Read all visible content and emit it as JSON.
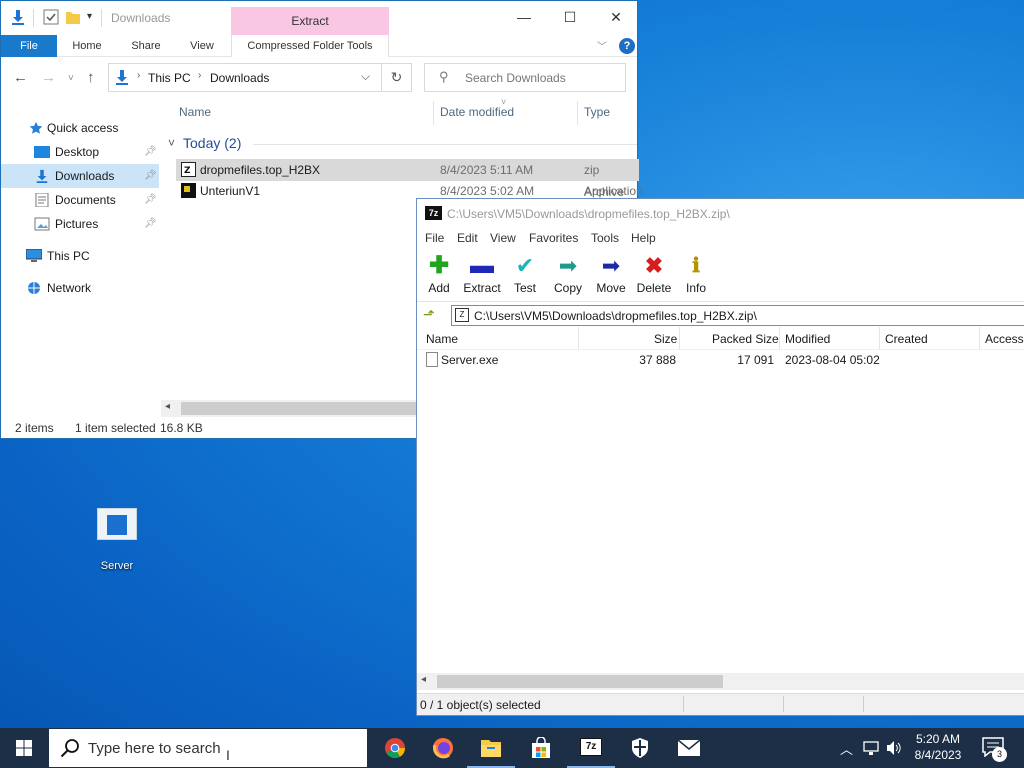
{
  "explorer": {
    "title": "Downloads",
    "context_tab": "Extract",
    "ribbon_tabs": [
      "File",
      "Home",
      "Share",
      "View",
      "Compressed Folder Tools"
    ],
    "breadcrumb": [
      "This PC",
      "Downloads"
    ],
    "search_placeholder": "Search Downloads",
    "nav": [
      {
        "label": "Quick access",
        "icon": "star-icon",
        "pinned": false
      },
      {
        "label": "Desktop",
        "icon": "desktop-folder-icon",
        "pinned": true
      },
      {
        "label": "Downloads",
        "icon": "downloads-icon",
        "pinned": true,
        "selected": true
      },
      {
        "label": "Documents",
        "icon": "documents-icon",
        "pinned": true
      },
      {
        "label": "Pictures",
        "icon": "pictures-icon",
        "pinned": true
      },
      {
        "label": "This PC",
        "icon": "computer-icon",
        "pinned": false
      },
      {
        "label": "Network",
        "icon": "network-icon",
        "pinned": false
      }
    ],
    "columns": [
      "Name",
      "Date modified",
      "Type"
    ],
    "group": "Today (2)",
    "files": [
      {
        "name": "dropmefiles.top_H2BX",
        "date": "8/4/2023 5:11 AM",
        "type": "zip Archive",
        "icon": "7z-archive-icon",
        "selected": true
      },
      {
        "name": "UnteriunV1",
        "date": "8/4/2023 5:02 AM",
        "type": "Application",
        "icon": "application-icon",
        "selected": false
      }
    ],
    "status": {
      "items": "2 items",
      "selected": "1 item selected",
      "size": "16.8 KB"
    }
  },
  "sevenzip": {
    "title": "C:\\Users\\VM5\\Downloads\\dropmefiles.top_H2BX.zip\\",
    "menu": [
      "File",
      "Edit",
      "View",
      "Favorites",
      "Tools",
      "Help"
    ],
    "toolbar": [
      {
        "label": "Add",
        "icon": "plus-icon",
        "color": "#21a521"
      },
      {
        "label": "Extract",
        "icon": "minus-icon",
        "color": "#2028b8"
      },
      {
        "label": "Test",
        "icon": "check-icon",
        "color": "#19b3b8"
      },
      {
        "label": "Copy",
        "icon": "double-arrow-right-icon",
        "color": "#1d9a8a"
      },
      {
        "label": "Move",
        "icon": "arrow-right-icon",
        "color": "#1c2aa8"
      },
      {
        "label": "Delete",
        "icon": "x-icon",
        "color": "#d61e1e"
      },
      {
        "label": "Info",
        "icon": "info-icon",
        "color": "#b39400"
      }
    ],
    "path": "C:\\Users\\VM5\\Downloads\\dropmefiles.top_H2BX.zip\\",
    "columns": [
      "Name",
      "Size",
      "Packed Size",
      "Modified",
      "Created",
      "Accessed"
    ],
    "rows": [
      {
        "name": "Server.exe",
        "size": "37 888",
        "packed": "17 091",
        "modified": "2023-08-04 05:02",
        "created": "",
        "accessed": ""
      }
    ],
    "status": "0 / 1 object(s) selected"
  },
  "desktop_icon": {
    "label": "Server"
  },
  "taskbar": {
    "search_placeholder": "Type here to search",
    "apps": [
      "chrome-icon",
      "firefox-icon",
      "file-explorer-icon",
      "store-icon",
      "7zip-icon",
      "defender-icon",
      "mail-icon"
    ],
    "time": "5:20 AM",
    "date": "8/4/2023",
    "notification_count": "3"
  }
}
